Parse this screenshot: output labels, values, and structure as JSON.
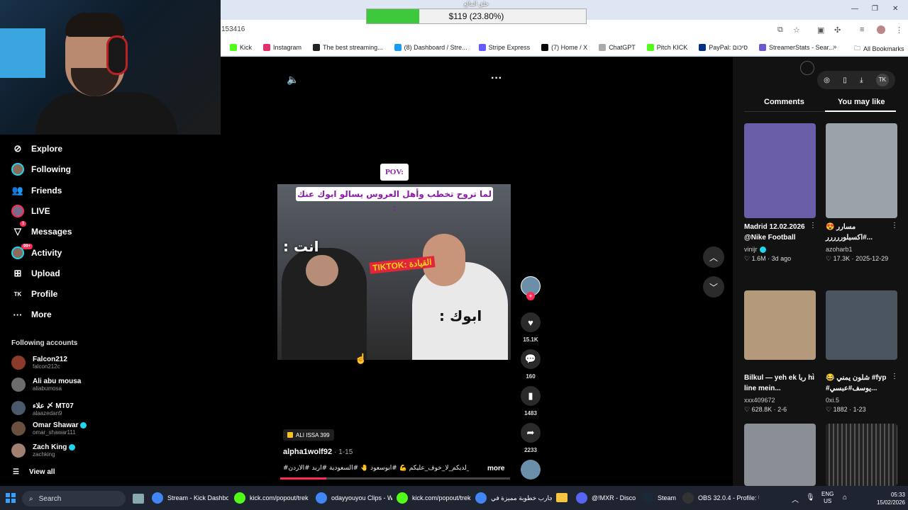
{
  "donation": {
    "title": "حلق المالع",
    "amount": "$119 (23.80%)",
    "fraction": 0.238
  },
  "browser": {
    "address": "153416",
    "bookmarks": [
      "Kick",
      "Instagram",
      "The best streaming...",
      "(8) Dashboard / Stre...",
      "Stripe Express",
      "(7) Home / X",
      "ChatGPT",
      "Pitch KICK",
      "PayPal: סיכום",
      "StreamerStats - Sear..."
    ],
    "bookmark_colors": [
      "#53fc18",
      "#e1306c",
      "#222222",
      "#1d9bf0",
      "#635bff",
      "#000000",
      "#aaaaaa",
      "#53fc18",
      "#003087",
      "#6a5acd"
    ],
    "all_bookmarks": "All Bookmarks"
  },
  "sidebar": {
    "nav": [
      {
        "label": "Explore",
        "icon": "compass-icon"
      },
      {
        "label": "Following",
        "icon": "following-avatar-icon"
      },
      {
        "label": "Friends",
        "icon": "friends-icon"
      },
      {
        "label": "LIVE",
        "icon": "live-icon"
      },
      {
        "label": "Messages",
        "icon": "messages-icon",
        "badge": "1"
      },
      {
        "label": "Activity",
        "icon": "activity-icon",
        "badge": "99+"
      },
      {
        "label": "Upload",
        "icon": "upload-icon"
      },
      {
        "label": "Profile",
        "icon": "profile-icon"
      },
      {
        "label": "More",
        "icon": "more-icon"
      }
    ],
    "following_title": "Following accounts",
    "accounts": [
      {
        "name": "Falcon212",
        "handle": "falcon212c",
        "verified": false
      },
      {
        "name": "Ali abu mousa",
        "handle": "aliabumosa",
        "verified": false
      },
      {
        "name": "علاء 〆 MT07",
        "handle": "alaazedan9",
        "verified": false
      },
      {
        "name": "Omar Shawar",
        "handle": "omar_shawar111",
        "verified": true
      },
      {
        "name": "Zach King",
        "handle": "zachking",
        "verified": true
      }
    ],
    "view_all": "View all"
  },
  "video": {
    "pov": "POV:",
    "caption": "لما تروح تخطب وأهل العروس يسالو ابوك عنك :",
    "label_you": "انت :",
    "label_dad": "ابوك :",
    "stamp": "TIKTOK: القيادة",
    "chip": "ALI ISSA 399",
    "author": "alpha1wolf92",
    "date": "1-15",
    "description": "#عبسي_لديكم_لا_خوف_عليكم 💪 #ابوسعود 🤚 #السعودية #اربد #الاردن ...",
    "more": "more",
    "progress": 0.2,
    "likes": "15.1K",
    "comments": "160",
    "saves": "1483",
    "shares": "2233"
  },
  "right_panel": {
    "tabs": [
      "Comments",
      "You may like"
    ],
    "active_tab": "You may like",
    "cards": [
      {
        "title": "Madrid 12.02.2026 @Nike Football",
        "author": "vinijr",
        "verified": true,
        "likes": "1.6M",
        "date": "3d ago",
        "color": "#6b5ea8"
      },
      {
        "title": "😍 مسارر #اكسبلوررررر...",
        "author": "azoharb1",
        "verified": false,
        "likes": "17.3K",
        "date": "2025-12-29",
        "color": "#9aa3a8"
      },
      {
        "title": "Bilkul — yeh ek ربا hi line mein...",
        "author": "xxx409672",
        "verified": false,
        "likes": "628.8K",
        "date": "2-6",
        "color": "#b49a7a"
      },
      {
        "title": "😂 شلون يمني #fyp #يوسف#عبسي...",
        "author": "0xi.5",
        "verified": false,
        "likes": "1882",
        "date": "1-23",
        "color": "#4a5560"
      }
    ]
  },
  "taskbar": {
    "search": "Search",
    "items": [
      {
        "label": "Stream - Kick Dashboa",
        "color": "#4285f4"
      },
      {
        "label": "kick.com/popout/trek",
        "color": "#53fc18"
      },
      {
        "label": "odayyouyou Clips - W",
        "color": "#4285f4"
      },
      {
        "label": "kick.com/popout/trek",
        "color": "#53fc18"
      },
      {
        "label": "تجارب خطوبة مميزة في",
        "color": "#4285f4"
      },
      {
        "label": "@!MXR - Disco",
        "color": "#5865f2"
      },
      {
        "label": "Steam",
        "color": "#1b2838"
      },
      {
        "label": "OBS 32.0.4 - Profile: U",
        "color": "#333333"
      }
    ],
    "lang": "ENG",
    "region": "US",
    "time": "05:33",
    "date": "15/02/2026"
  }
}
